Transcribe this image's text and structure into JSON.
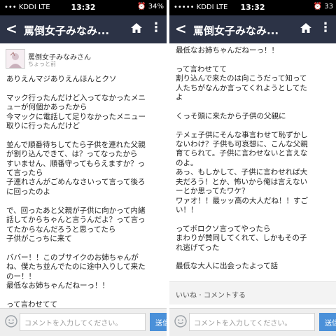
{
  "status": {
    "carrier_left": "••• KDDI  LTE",
    "carrier_right": "••••• KDDI  LTE",
    "time": "13:32",
    "battery_left": "34%",
    "battery_right": "33"
  },
  "nav": {
    "back_label": "<",
    "title": "罵倒女子みなみ...",
    "more_label": "⋮"
  },
  "post": {
    "author": "罵倒女子みなみさん",
    "posted": "ちょっと前",
    "left_text": "ありえんマジありえんほんとクソ\n\nマック行ったんだけど入ってなかったメニ\nューが何個かあったから\n今マックに電話して足りなかったメニュー\n取りに行ったんだけど\n\n並んで順番待ちしてたら子供を連れた父親\nが割り込んできて、は？ってなったから\nすいません、順番守ってもらえますか？っ\nて言ったら\n子連れさんがごめんなさいって言って後ろ\nに回ったのよ\n\nで、回ったあと父親が子供に向かって内緒\n話してからちゃんと言うんだよ？って言っ\nてたからなんだろうと思ってたら\n子供がこっちに来て\n\nババー！！このブサイクのお姉ちゃんが\nね、僕たち並んでたのに途中入りして来た\nのー！！\n最低なお姉ちゃんだねーっ！！\n\nって言わせてて",
    "right_text": "最低なお姉ちゃんだねーっ！！\n\nって言わせてて\n割り込んで来たのは向こうだって知って\n人たちがなんか言ってくれようとしてた\nよ\n\nくっそ頭に来たから子供の父親に\n\nテメェ子供にそんな事言わせて恥ずかし\nないわけ？子供も可哀想に、こんな父親\n育てられて。子供に言わせないと言えな\nのよ。\nあっ、もしかして、子供に言わせれば大\n夫だろう！とか、怖いから俺は言えない\nーとか思ってたワケ？\nワァオ！！最ッッ高の大人だね！！すご\nい！！\n\nってボロクソ言ってやったら\nまわりが賛同してくれて、しかもその子\nれ逃げてった\n\n最低な大人に出会ったよって話"
  },
  "actions": {
    "like": "いいね",
    "separator": "・",
    "comment": "コメントする"
  },
  "comment": {
    "placeholder": "コメントを入力してください。",
    "send_label": "送信"
  },
  "colors": {
    "navbar": "#2c3346",
    "status_bar": "#000000",
    "send_button": "#4a90d9"
  },
  "icons": [
    "back-icon",
    "home-icon",
    "more-icon",
    "smile-icon",
    "signal-icon",
    "alarm-icon"
  ]
}
